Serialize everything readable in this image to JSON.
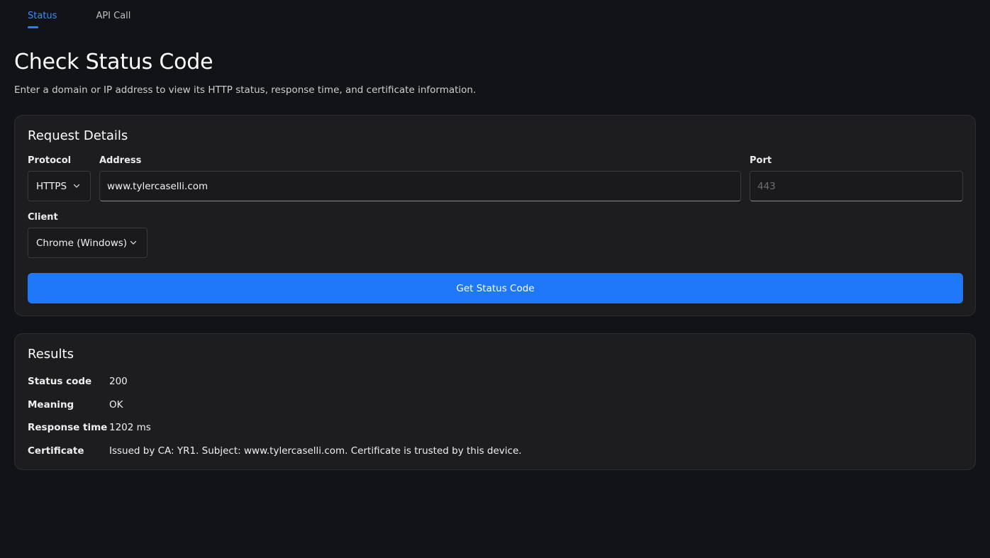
{
  "tabs": [
    {
      "label": "Status",
      "active": true
    },
    {
      "label": "API Call",
      "active": false
    }
  ],
  "header": {
    "title": "Check Status Code",
    "subtitle": "Enter a domain or IP address to view its HTTP status, response time, and certificate information."
  },
  "request": {
    "title": "Request Details",
    "protocol": {
      "label": "Protocol",
      "value": "HTTPS"
    },
    "address": {
      "label": "Address",
      "value": "www.tylercaselli.com"
    },
    "port": {
      "label": "Port",
      "value": "",
      "placeholder": "443"
    },
    "client": {
      "label": "Client",
      "value": "Chrome (Windows)"
    },
    "submit_label": "Get Status Code"
  },
  "results": {
    "title": "Results",
    "rows": [
      {
        "key": "Status code",
        "value": "200"
      },
      {
        "key": "Meaning",
        "value": "OK"
      },
      {
        "key": "Response time",
        "value": "1202 ms"
      },
      {
        "key": "Certificate",
        "value": "Issued by CA: YR1. Subject: www.tylercaselli.com. Certificate is trusted by this device."
      }
    ]
  },
  "colors": {
    "background": "#121316",
    "card": "#1d1d1f",
    "accent": "#1f77fa",
    "tab_active": "#3b8cff"
  },
  "icons": {
    "protocol_select": "chevron-down-icon",
    "client_select": "chevron-down-icon"
  }
}
